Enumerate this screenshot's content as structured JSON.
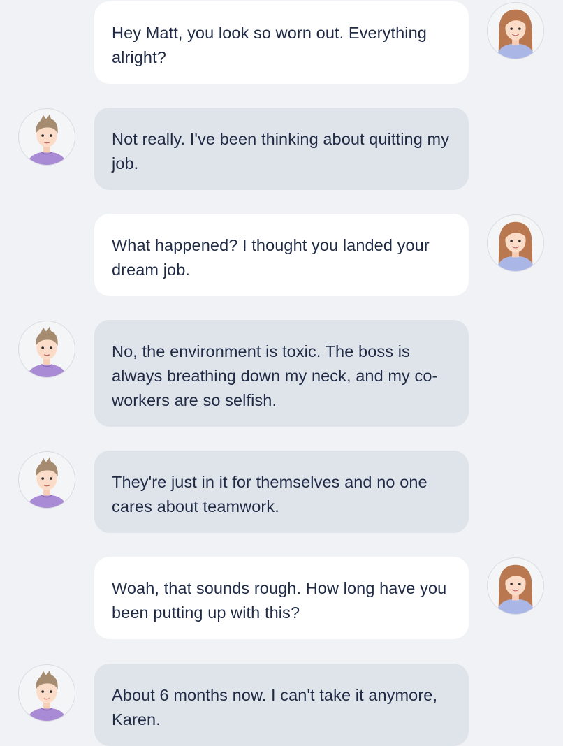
{
  "participants": {
    "karen": {
      "avatar_icon": "female-user-avatar-icon",
      "bubble_color": "#ffffff"
    },
    "matt": {
      "avatar_icon": "male-user-avatar-icon",
      "bubble_color": "#dfe3ea"
    }
  },
  "messages": [
    {
      "sender": "karen",
      "text": "Hey Matt, you look so worn out. Everything alright?"
    },
    {
      "sender": "matt",
      "text": "Not really. I've been thinking about quitting my job."
    },
    {
      "sender": "karen",
      "text": "What happened? I thought you landed your dream job."
    },
    {
      "sender": "matt",
      "text": "No, the environment is toxic. The boss is always breathing down my neck, and my co-workers are so selfish."
    },
    {
      "sender": "matt",
      "text": "They're just in it for themselves and no one cares about teamwork."
    },
    {
      "sender": "karen",
      "text": "Woah, that sounds rough. How long have you been putting up with this?"
    },
    {
      "sender": "matt",
      "text": "About 6 months now. I can't take it anymore, Karen."
    }
  ]
}
